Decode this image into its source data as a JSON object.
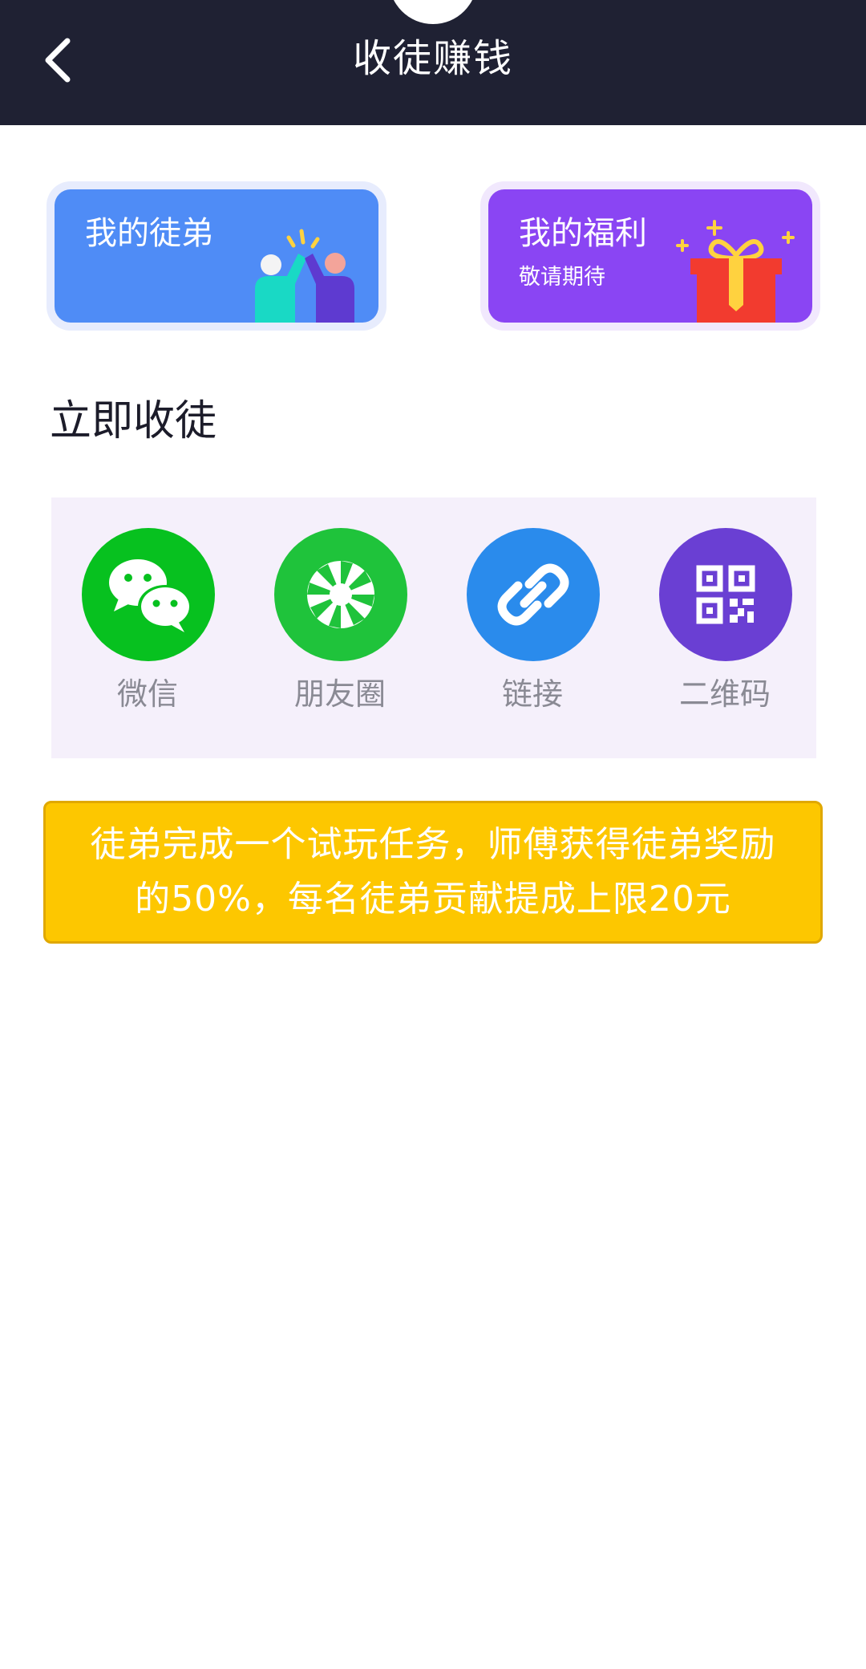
{
  "header": {
    "title": "收徒赚钱",
    "back_icon": "chevron-left-icon"
  },
  "cards": {
    "disciples": {
      "title": "我的徒弟",
      "icon": "high-five-icon"
    },
    "welfare": {
      "title": "我的福利",
      "subtitle": "敬请期待",
      "icon": "gift-icon"
    }
  },
  "section": {
    "title": "立即收徒"
  },
  "share": {
    "items": [
      {
        "label": "微信",
        "icon": "wechat-icon",
        "color": "#07c11f"
      },
      {
        "label": "朋友圈",
        "icon": "moments-icon",
        "color": "#1fc33b"
      },
      {
        "label": "链接",
        "icon": "link-icon",
        "color": "#2a8bec"
      },
      {
        "label": "二维码",
        "icon": "qrcode-icon",
        "color": "#6a3fd3"
      }
    ]
  },
  "banner": {
    "line1": "徒弟完成一个试玩任务，师傅获得徒弟奖励",
    "line2": "的50%，每名徒弟贡献提成上限20元"
  },
  "colors": {
    "header_bg": "#1f2133",
    "card_blue": "#4f8cf6",
    "card_purple": "#8a45f3",
    "banner_yellow": "#fdc700"
  }
}
